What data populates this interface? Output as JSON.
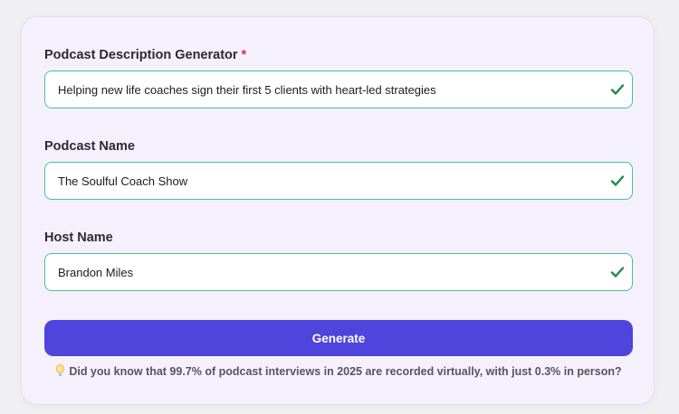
{
  "form": {
    "description": {
      "label": "Podcast Description Generator",
      "required_mark": "*",
      "value": "Helping new life coaches sign their first 5 clients with heart-led strategies"
    },
    "podcast_name": {
      "label": "Podcast Name",
      "value": "The Soulful Coach Show"
    },
    "host_name": {
      "label": "Host Name",
      "value": "Brandon Miles"
    },
    "generate_label": "Generate",
    "tip_text": "Did you know that 99.7% of podcast interviews in 2025 are recorded virtually, with just 0.3% in person?"
  },
  "colors": {
    "accent": "#4f44db",
    "field_border": "#46bfa7",
    "check": "#1f8a4c",
    "required": "#e0245e",
    "card_bg": "#f4f1fd"
  },
  "icons": {
    "valid": "check-icon",
    "tip": "lightbulb-icon"
  }
}
